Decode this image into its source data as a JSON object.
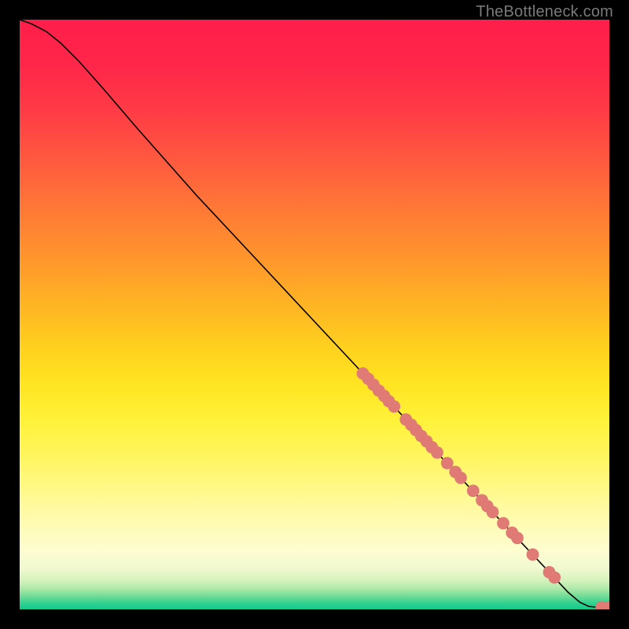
{
  "watermark": "TheBottleneck.com",
  "colors": {
    "background": "#000000",
    "curve": "#000000",
    "dot": "#e07a74",
    "watermark": "#7a7a7a"
  },
  "chart_data": {
    "type": "line",
    "title": "",
    "xlabel": "",
    "ylabel": "",
    "xlim": [
      0,
      100
    ],
    "ylim": [
      0,
      100
    ],
    "background_gradient": [
      {
        "pos": 0.0,
        "color": "#ff1e4b"
      },
      {
        "pos": 0.08,
        "color": "#ff2749"
      },
      {
        "pos": 0.16,
        "color": "#ff3d45"
      },
      {
        "pos": 0.24,
        "color": "#ff5a3f"
      },
      {
        "pos": 0.32,
        "color": "#ff7836"
      },
      {
        "pos": 0.4,
        "color": "#ff942d"
      },
      {
        "pos": 0.48,
        "color": "#ffb324"
      },
      {
        "pos": 0.56,
        "color": "#ffd21e"
      },
      {
        "pos": 0.62,
        "color": "#ffe522"
      },
      {
        "pos": 0.68,
        "color": "#fff23a"
      },
      {
        "pos": 0.74,
        "color": "#fff55e"
      },
      {
        "pos": 0.8,
        "color": "#fff98c"
      },
      {
        "pos": 0.85,
        "color": "#fffbb0"
      },
      {
        "pos": 0.9,
        "color": "#fdfdd0"
      },
      {
        "pos": 0.93,
        "color": "#f1f9d0"
      },
      {
        "pos": 0.95,
        "color": "#d7f3be"
      },
      {
        "pos": 0.965,
        "color": "#aee9a9"
      },
      {
        "pos": 0.978,
        "color": "#6fdb96"
      },
      {
        "pos": 0.99,
        "color": "#2ed18f"
      },
      {
        "pos": 1.0,
        "color": "#14c98c"
      }
    ],
    "curve": [
      {
        "x": 0.0,
        "y": 100.0
      },
      {
        "x": 2.0,
        "y": 99.3
      },
      {
        "x": 4.5,
        "y": 98.0
      },
      {
        "x": 7.0,
        "y": 96.0
      },
      {
        "x": 10.0,
        "y": 93.0
      },
      {
        "x": 14.0,
        "y": 88.5
      },
      {
        "x": 20.0,
        "y": 81.5
      },
      {
        "x": 30.0,
        "y": 70.2
      },
      {
        "x": 40.0,
        "y": 59.5
      },
      {
        "x": 50.0,
        "y": 48.8
      },
      {
        "x": 60.0,
        "y": 38.1
      },
      {
        "x": 70.0,
        "y": 27.4
      },
      {
        "x": 80.0,
        "y": 16.7
      },
      {
        "x": 90.0,
        "y": 6.1
      },
      {
        "x": 93.0,
        "y": 2.9
      },
      {
        "x": 95.0,
        "y": 1.2
      },
      {
        "x": 96.5,
        "y": 0.5
      },
      {
        "x": 98.0,
        "y": 0.35
      },
      {
        "x": 100.0,
        "y": 0.35
      }
    ],
    "dots": [
      {
        "x": 58.2,
        "y": 40.0
      },
      {
        "x": 59.1,
        "y": 39.1
      },
      {
        "x": 60.0,
        "y": 38.1
      },
      {
        "x": 60.9,
        "y": 37.1
      },
      {
        "x": 61.8,
        "y": 36.2
      },
      {
        "x": 62.6,
        "y": 35.3
      },
      {
        "x": 63.5,
        "y": 34.4
      },
      {
        "x": 65.5,
        "y": 32.2
      },
      {
        "x": 66.4,
        "y": 31.3
      },
      {
        "x": 67.2,
        "y": 30.4
      },
      {
        "x": 68.1,
        "y": 29.4
      },
      {
        "x": 69.0,
        "y": 28.5
      },
      {
        "x": 69.9,
        "y": 27.5
      },
      {
        "x": 70.8,
        "y": 26.6
      },
      {
        "x": 72.5,
        "y": 24.8
      },
      {
        "x": 73.9,
        "y": 23.3
      },
      {
        "x": 74.8,
        "y": 22.3
      },
      {
        "x": 76.9,
        "y": 20.1
      },
      {
        "x": 78.4,
        "y": 18.5
      },
      {
        "x": 79.3,
        "y": 17.5
      },
      {
        "x": 80.2,
        "y": 16.5
      },
      {
        "x": 82.0,
        "y": 14.6
      },
      {
        "x": 83.5,
        "y": 13.0
      },
      {
        "x": 84.4,
        "y": 12.1
      },
      {
        "x": 87.0,
        "y": 9.3
      },
      {
        "x": 89.8,
        "y": 6.3
      },
      {
        "x": 90.7,
        "y": 5.4
      },
      {
        "x": 98.7,
        "y": 0.35
      },
      {
        "x": 100.0,
        "y": 0.35
      }
    ],
    "dot_radius": 1.05
  }
}
